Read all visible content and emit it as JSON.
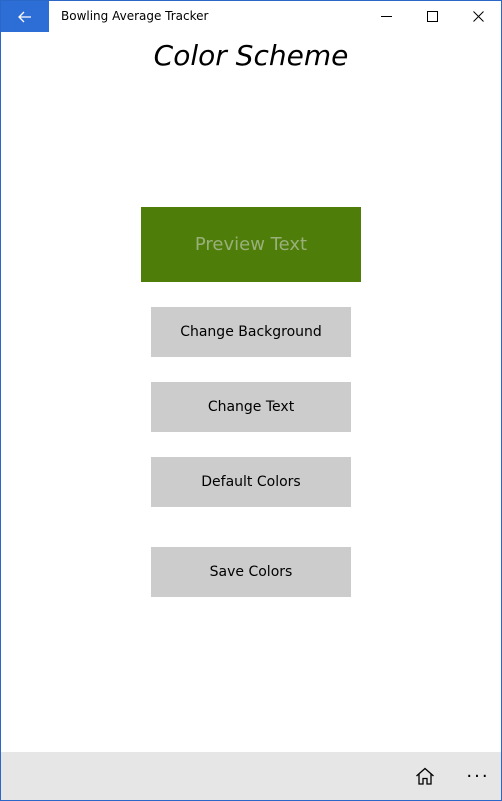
{
  "window": {
    "title": "Bowling Average Tracker",
    "accent_color": "#2c6ed5"
  },
  "titlebar": {
    "back_icon": "back-arrow-icon",
    "minimize_icon": "minimize-icon",
    "maximize_icon": "maximize-icon",
    "close_icon": "close-icon"
  },
  "page": {
    "title": "Color Scheme"
  },
  "preview": {
    "text": "Preview Text",
    "background_color": "#4e7d0a",
    "text_color": "#9ab07a"
  },
  "buttons": {
    "change_background": "Change Background",
    "change_text": "Change Text",
    "default_colors": "Default Colors",
    "save_colors": "Save Colors"
  },
  "command_bar": {
    "home_icon": "home-icon",
    "more_icon": "more-icon",
    "more_glyph": "···"
  }
}
